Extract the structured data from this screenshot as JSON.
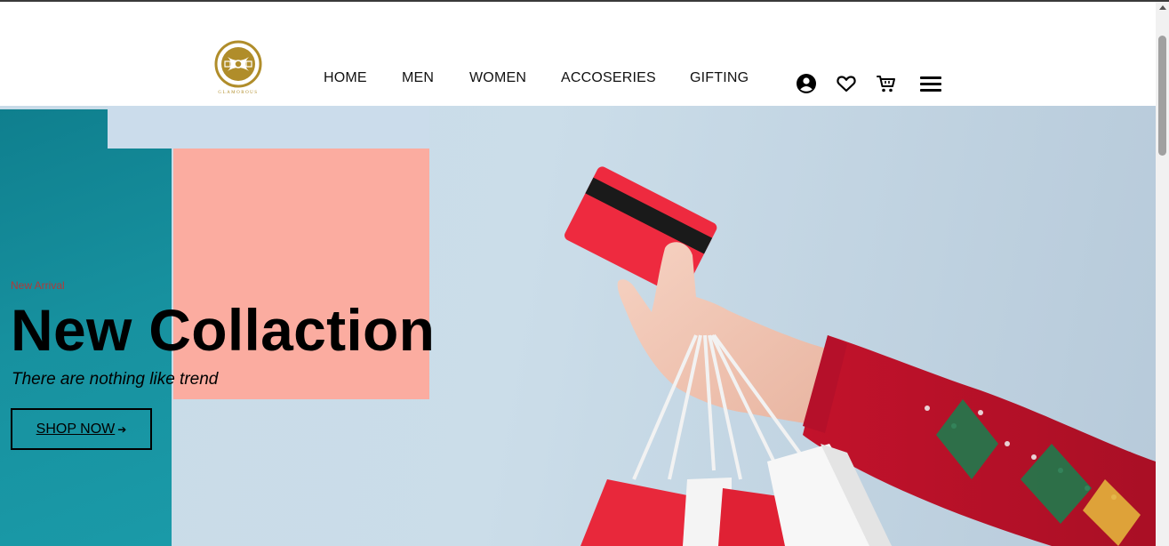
{
  "header": {
    "logo_text": "GLAMOROUS",
    "nav": [
      {
        "label": "HOME"
      },
      {
        "label": "MEN"
      },
      {
        "label": "WOMEN"
      },
      {
        "label": "ACCOSERIES"
      },
      {
        "label": "GIFTING"
      }
    ],
    "icons": [
      "account-icon",
      "heart-icon",
      "cart-icon",
      "menu-icon"
    ]
  },
  "hero": {
    "tag": "New Arrival",
    "headline": "New Collaction",
    "subtitle": "There are nothing like trend",
    "cta_label": "SHOP NOW",
    "cta_arrow": "➔"
  },
  "colors": {
    "teal": "#17919f",
    "pink": "#fbaca0",
    "light_blue": "#cbdceb",
    "gold": "#b08d2a",
    "tag_red": "#b03a3a"
  }
}
